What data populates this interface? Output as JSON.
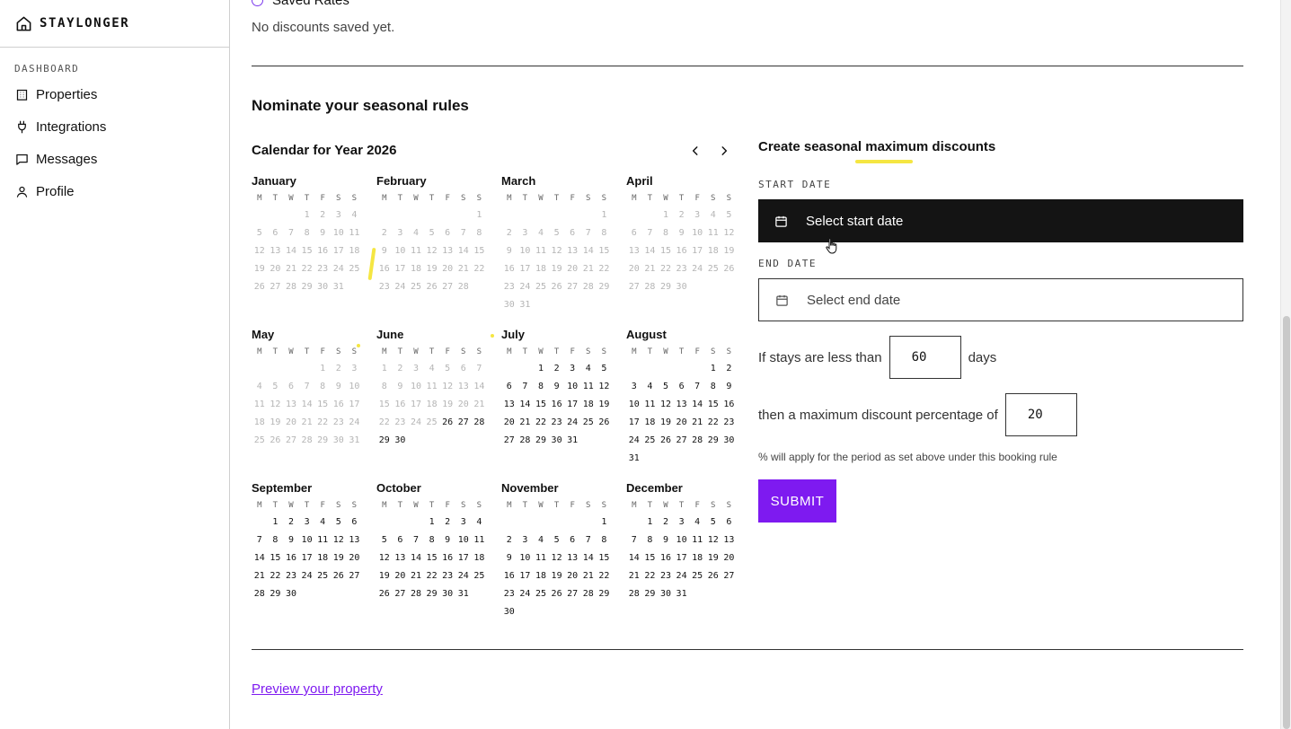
{
  "brand": {
    "name": "STAYLONGER"
  },
  "sidebar": {
    "section": "DASHBOARD",
    "items": [
      {
        "label": "Properties",
        "icon": "building-icon"
      },
      {
        "label": "Integrations",
        "icon": "plug-icon"
      },
      {
        "label": "Messages",
        "icon": "message-icon"
      },
      {
        "label": "Profile",
        "icon": "user-icon"
      }
    ]
  },
  "saved": {
    "title": "Saved Rates",
    "empty": "No discounts saved yet."
  },
  "seasonal": {
    "title": "Nominate your seasonal rules"
  },
  "calendar": {
    "title": "Calendar for Year 2026",
    "weekdays": [
      "M",
      "T",
      "W",
      "T",
      "F",
      "S",
      "S"
    ],
    "months": [
      {
        "name": "January",
        "offset": 3,
        "days": 31,
        "past_through": 31
      },
      {
        "name": "February",
        "offset": 6,
        "days": 28,
        "past_through": 28
      },
      {
        "name": "March",
        "offset": 6,
        "days": 31,
        "past_through": 31
      },
      {
        "name": "April",
        "offset": 2,
        "days": 30,
        "past_through": 30
      },
      {
        "name": "May",
        "offset": 4,
        "days": 31,
        "past_through": 31
      },
      {
        "name": "June",
        "offset": 0,
        "days": 30,
        "past_through": 25
      },
      {
        "name": "July",
        "offset": 2,
        "days": 31,
        "past_through": 0
      },
      {
        "name": "August",
        "offset": 5,
        "days": 31,
        "past_through": 0
      },
      {
        "name": "September",
        "offset": 1,
        "days": 30,
        "past_through": 0
      },
      {
        "name": "October",
        "offset": 3,
        "days": 31,
        "past_through": 0
      },
      {
        "name": "November",
        "offset": 6,
        "days": 30,
        "past_through": 0
      },
      {
        "name": "December",
        "offset": 1,
        "days": 31,
        "past_through": 0
      }
    ]
  },
  "form": {
    "title": "Create seasonal maximum discounts",
    "start_label": "START DATE",
    "start_placeholder": "Select start date",
    "end_label": "END DATE",
    "end_placeholder": "Select end date",
    "stays_prefix": "If stays are less than",
    "stays_value": "60",
    "stays_suffix": "days",
    "discount_prefix": "then a maximum discount percentage of",
    "discount_value": "20",
    "note": "% will apply for the period as set above under this booking rule",
    "submit_label": "SUBMIT"
  },
  "footer": {
    "preview_link": "Preview your property"
  },
  "colors": {
    "accent": "#7e1af0",
    "highlight": "#f5e642",
    "dark_field": "#141414"
  }
}
